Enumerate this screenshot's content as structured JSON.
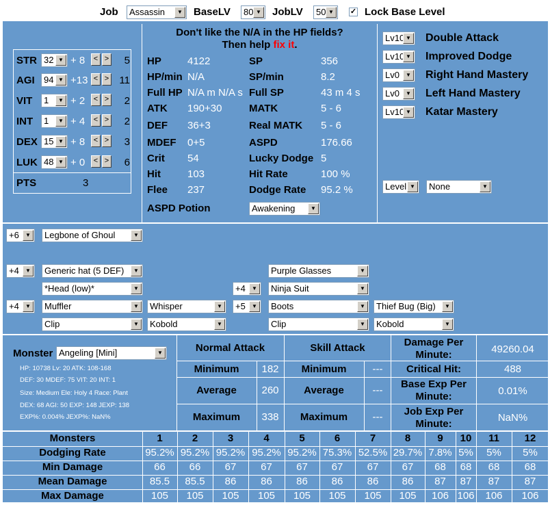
{
  "top": {
    "job_label": "Job",
    "job_value": "Assassin",
    "baselv_label": "BaseLV",
    "baselv_value": "80",
    "joblv_label": "JobLV",
    "joblv_value": "50",
    "lock_label": "Lock Base Level"
  },
  "stats": [
    {
      "name": "STR",
      "base": "32",
      "bonus": "+ 8",
      "cost": "5"
    },
    {
      "name": "AGI",
      "base": "94",
      "bonus": "+13",
      "cost": "11"
    },
    {
      "name": "VIT",
      "base": "1",
      "bonus": "+ 2",
      "cost": "2"
    },
    {
      "name": "INT",
      "base": "1",
      "bonus": "+ 4",
      "cost": "2"
    },
    {
      "name": "DEX",
      "base": "15",
      "bonus": "+ 8",
      "cost": "3"
    },
    {
      "name": "LUK",
      "base": "48",
      "bonus": "+ 0",
      "cost": "6"
    }
  ],
  "pts": {
    "label": "PTS",
    "value": "3"
  },
  "notice": {
    "line1": "Don't like the N/A in the HP fields?",
    "line2a": "Then help ",
    "link": "fix it",
    "line2b": "."
  },
  "derived_left": [
    {
      "label": "HP",
      "value": "4122"
    },
    {
      "label": "HP/min",
      "value": "N/A"
    },
    {
      "label": "Full HP",
      "value": "N/A m N/A s"
    },
    {
      "label": "ATK",
      "value": "190+30"
    },
    {
      "label": "DEF",
      "value": "36+3"
    },
    {
      "label": "MDEF",
      "value": "0+5"
    },
    {
      "label": "Crit",
      "value": "54"
    },
    {
      "label": "Hit",
      "value": "103"
    },
    {
      "label": "Flee",
      "value": "237"
    }
  ],
  "derived_right": [
    {
      "label": "SP",
      "value": "356"
    },
    {
      "label": "SP/min",
      "value": "8.2"
    },
    {
      "label": "Full SP",
      "value": "43 m 4 s"
    },
    {
      "label": "MATK",
      "value": "5 - 6"
    },
    {
      "label": "Real MATK",
      "value": "5 - 6"
    },
    {
      "label": "ASPD",
      "value": "176.66"
    },
    {
      "label": "Lucky Dodge",
      "value": "5"
    },
    {
      "label": "Hit Rate",
      "value": "100 %"
    },
    {
      "label": "Dodge Rate",
      "value": "95.2 %"
    }
  ],
  "aspd_potion": {
    "label": "ASPD Potion",
    "value": "Awakening"
  },
  "skills": [
    {
      "level": "Lv10",
      "name": "Double Attack"
    },
    {
      "level": "Lv10",
      "name": "Improved Dodge"
    },
    {
      "level": "Lv0",
      "name": "Right Hand Mastery"
    },
    {
      "level": "Lv0",
      "name": "Left Hand Mastery"
    },
    {
      "level": "Lv10",
      "name": "Katar Mastery"
    }
  ],
  "extra_skill": {
    "level": "Level",
    "name": "None"
  },
  "equipment": {
    "weapon_refine": "+6",
    "weapon": "Legbone of Ghoul",
    "head_refine": "+4",
    "head_top": "Generic hat (5 DEF)",
    "head_mid": "Purple Glasses",
    "head_low": "*Head (low)*",
    "armor_refine": "+4",
    "armor": "Ninja Suit",
    "garment_refine": "+4",
    "garment": "Muffler",
    "garment_card": "Whisper",
    "shoes_refine": "+5",
    "shoes": "Boots",
    "shoes_card": "Thief Bug (Big)",
    "acc1": "Clip",
    "acc1_card": "Kobold",
    "acc2": "Clip",
    "acc2_card": "Kobold"
  },
  "monster": {
    "label": "Monster",
    "value": "Angeling [Mini]",
    "info": [
      [
        [
          "HP: ",
          ""
        ],
        [
          "10738",
          ""
        ],
        [
          " Lv: ",
          ""
        ],
        [
          "20",
          ""
        ],
        [
          " ATK: ",
          ""
        ],
        [
          "108-168",
          ""
        ]
      ],
      [
        [
          "DEF: ",
          ""
        ],
        [
          "30",
          ""
        ],
        [
          " MDEF: ",
          ""
        ],
        [
          "75",
          ""
        ],
        [
          " VIT: ",
          ""
        ],
        [
          "20",
          ""
        ],
        [
          " INT: ",
          ""
        ],
        [
          "1",
          ""
        ]
      ],
      [
        [
          "Size: ",
          ""
        ],
        [
          "Medium",
          ""
        ],
        [
          " Ele: ",
          ""
        ],
        [
          "Holy 4",
          ""
        ],
        [
          " Race: ",
          ""
        ],
        [
          "Plant",
          ""
        ]
      ],
      [
        [
          "DEX: ",
          ""
        ],
        [
          "68",
          ""
        ],
        [
          " AGI: ",
          ""
        ],
        [
          "50",
          ""
        ],
        [
          " EXP: ",
          ""
        ],
        [
          "148",
          ""
        ],
        [
          " JEXP: ",
          ""
        ],
        [
          "138",
          ""
        ]
      ],
      [
        [
          "EXP%: ",
          ""
        ],
        [
          "0.004%",
          ""
        ],
        [
          " JEXP%: ",
          ""
        ],
        [
          "NaN%",
          ""
        ]
      ]
    ]
  },
  "damage": {
    "normal_header": "Normal Attack",
    "skill_header": "Skill Attack",
    "min_label": "Minimum",
    "avg_label": "Average",
    "max_label": "Maximum",
    "normal_min": "182",
    "normal_avg": "260",
    "normal_max": "338",
    "skill_min": "---",
    "skill_avg": "---",
    "skill_max": "---",
    "dpm_label": "Damage Per Minute:",
    "dpm_value": "49260.04",
    "crit_label": "Critical Hit:",
    "crit_value": "488",
    "bexp_label": "Base Exp Per Minute:",
    "bexp_value": "0.01%",
    "jexp_label": "Job Exp Per Minute:",
    "jexp_value": "NaN%"
  },
  "table": {
    "headers": [
      "Monsters",
      "1",
      "2",
      "3",
      "4",
      "5",
      "6",
      "7",
      "8",
      "9",
      "10",
      "11",
      "12"
    ],
    "rows": [
      {
        "label": "Dodging Rate",
        "values": [
          "95.2%",
          "95.2%",
          "95.2%",
          "95.2%",
          "95.2%",
          "75.3%",
          "52.5%",
          "29.7%",
          "7.8%",
          "5%",
          "5%",
          "5%"
        ]
      },
      {
        "label": "Min Damage",
        "values": [
          "66",
          "66",
          "67",
          "67",
          "67",
          "67",
          "67",
          "67",
          "68",
          "68",
          "68",
          "68"
        ]
      },
      {
        "label": "Mean Damage",
        "values": [
          "85.5",
          "85.5",
          "86",
          "86",
          "86",
          "86",
          "86",
          "86",
          "87",
          "87",
          "87",
          "87"
        ]
      },
      {
        "label": "Max Damage",
        "values": [
          "105",
          "105",
          "105",
          "105",
          "105",
          "105",
          "105",
          "105",
          "106",
          "106",
          "106",
          "106"
        ]
      }
    ]
  }
}
